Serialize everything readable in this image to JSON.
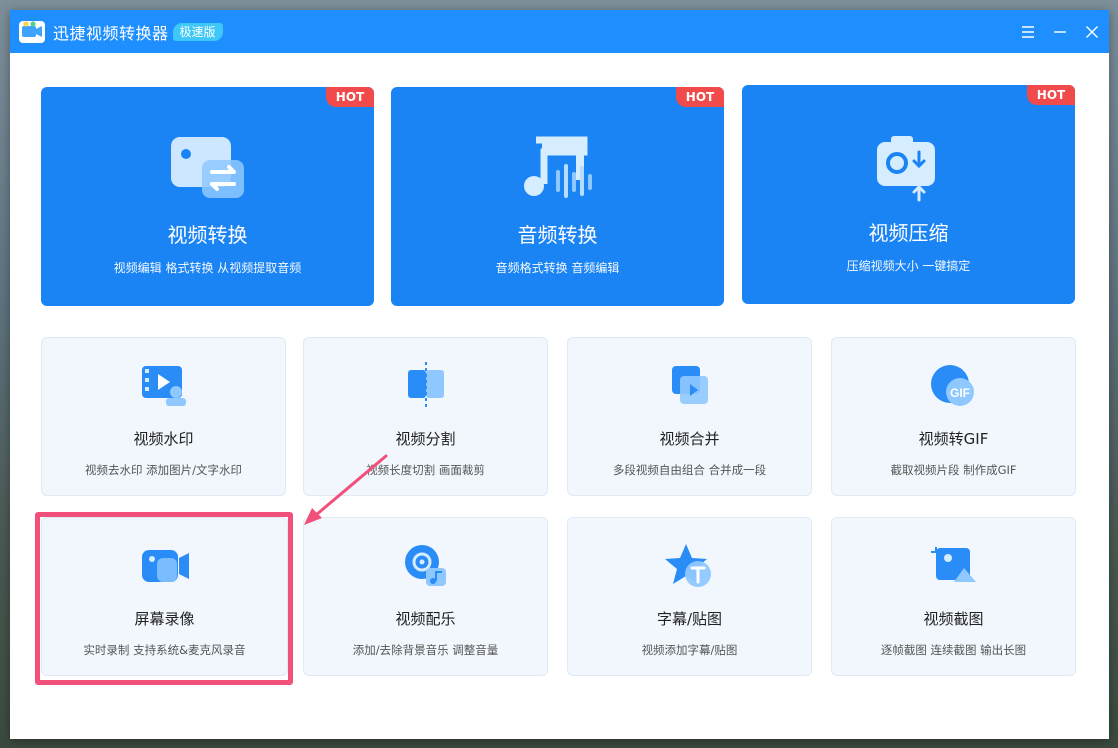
{
  "app": {
    "title": "迅捷视频转换器",
    "edition": "极速版",
    "colors": {
      "titlebar": "#1f8fff",
      "accent": "#1a84f5",
      "hot": "#f04a4a",
      "highlight": "#f0507a"
    }
  },
  "window_controls": {
    "menu_icon": "menu-icon",
    "minimize_icon": "minimize-icon",
    "close_icon": "close-icon"
  },
  "top_tools": [
    {
      "title": "视频转换",
      "desc": "视频编辑 格式转换 从视频提取音频",
      "badge": "HOT",
      "icon": "video-convert-icon"
    },
    {
      "title": "音频转换",
      "desc": "音频格式转换 音频编辑",
      "badge": "HOT",
      "icon": "audio-convert-icon"
    },
    {
      "title": "视频压缩",
      "desc": "压缩视频大小 一键搞定",
      "badge": "HOT",
      "icon": "video-compress-icon"
    }
  ],
  "tools": [
    {
      "title": "视频水印",
      "desc": "视频去水印 添加图片/文字水印",
      "icon": "video-watermark-icon"
    },
    {
      "title": "视频分割",
      "desc": "视频长度切割 画面裁剪",
      "icon": "video-split-icon"
    },
    {
      "title": "视频合并",
      "desc": "多段视频自由组合 合并成一段",
      "icon": "video-merge-icon"
    },
    {
      "title": "视频转GIF",
      "desc": "截取视频片段 制作成GIF",
      "icon": "video-to-gif-icon",
      "icon_text": "GIF"
    },
    {
      "title": "屏幕录像",
      "desc": "实时录制 支持系统&麦克风录音",
      "icon": "screen-record-icon",
      "highlighted": true
    },
    {
      "title": "视频配乐",
      "desc": "添加/去除背景音乐 调整音量",
      "icon": "video-music-icon"
    },
    {
      "title": "字幕/贴图",
      "desc": "视频添加字幕/贴图",
      "icon": "subtitle-sticker-icon"
    },
    {
      "title": "视频截图",
      "desc": "逐帧截图 连续截图 输出长图",
      "icon": "video-screenshot-icon"
    }
  ]
}
